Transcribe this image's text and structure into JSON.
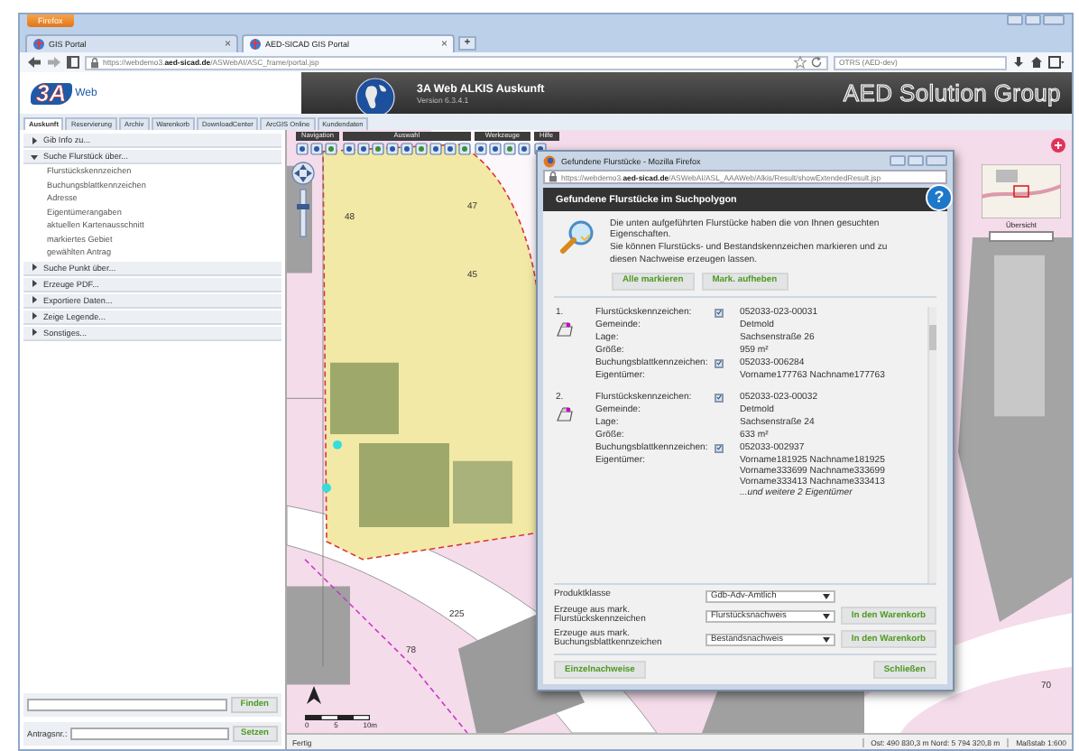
{
  "browser": {
    "menu_button": "Firefox",
    "tabs": [
      {
        "label": "GIS Portal",
        "close": "×",
        "selected": false
      },
      {
        "label": "AED-SICAD GIS Portal",
        "close": "×",
        "selected": true
      }
    ],
    "new_tab": "+",
    "url": "https://webdemo3.**aed-sicad.de**/ASWebAI/ASC_frame/portal.jsp",
    "search_placeholder": "OTRS (AED-dev)"
  },
  "header": {
    "logo": "3A",
    "logo_suffix": "Web",
    "title": "3A Web ALKIS Auskunft",
    "version": "Version 6.3.4.1",
    "brand": "AED Solution Group"
  },
  "app_tabs": [
    {
      "label": "Auskunft",
      "selected": true
    },
    {
      "label": "Reservierung",
      "selected": false
    },
    {
      "label": "Archiv",
      "selected": false
    },
    {
      "label": "Warenkorb",
      "selected": false
    },
    {
      "label": "DownloadCenter",
      "selected": false
    },
    {
      "label": "ArcGIS Online",
      "selected": false
    },
    {
      "label": "Kundendaten",
      "selected": false
    }
  ],
  "sidebar": {
    "sections": [
      {
        "label": "Gib Info zu...",
        "expanded": false
      },
      {
        "label": "Suche Flurstück über...",
        "expanded": true,
        "children": [
          {
            "label": "Flurstückskennzeichen"
          },
          {
            "label": "Buchungsblattkennzeichen"
          },
          {
            "label": "Adresse"
          },
          {
            "label": "Eigentümerangaben"
          },
          {
            "label": "aktuellen Kartenausschnitt"
          },
          {
            "label": "markiertes Gebiet"
          },
          {
            "label": "gewählten Antrag"
          }
        ]
      },
      {
        "label": "Suche Punkt über...",
        "expanded": false
      },
      {
        "label": "Erzeuge PDF...",
        "expanded": false
      },
      {
        "label": "Exportiere Daten...",
        "expanded": false
      },
      {
        "label": "Zeige Legende...",
        "expanded": false
      },
      {
        "label": "Sonstiges...",
        "expanded": false
      }
    ],
    "search_button": "Finden",
    "request_label": "Antragsnr.:",
    "request_button": "Setzen"
  },
  "map": {
    "toolbar": [
      "Navigation",
      "Auswahl",
      "Werkzeuge",
      "Hilfe"
    ],
    "labels": [
      "48",
      "47",
      "45",
      "225",
      "78",
      "70"
    ],
    "scale_labels": [
      "0",
      "5",
      "10m"
    ],
    "overview": "Übersicht"
  },
  "dialog": {
    "window_title": "Gefundene Flurstücke - Mozilla Firefox",
    "url": "https://webdemo3.**aed-sicad.de**/ASWebAI/ASL_AAAWeb/Alkis/Result/showExtendedResult.jsp",
    "heading": "Gefundene Flurstücke im Suchpolygon",
    "help": "?",
    "intro": [
      "Die unten aufgeführten Flurstücke haben die von Ihnen gesuchten Eigenschaften.",
      "Sie können Flurstücks- und Bestandskennzeichen markieren und zu diesen Nachweise erzeugen lassen."
    ],
    "buttons": [
      "Alle markieren",
      "Mark. aufheben"
    ],
    "results": [
      {
        "number": "1.",
        "fields": [
          {
            "kind": "check",
            "label": "Flurstückskennzeichen:",
            "checked": true,
            "lines": [
              "052033-023-00031"
            ]
          },
          {
            "kind": "plain",
            "label": "Gemeinde:",
            "lines": [
              "Detmold"
            ]
          },
          {
            "kind": "plain",
            "label": "Lage:",
            "lines": [
              "Sachsenstraße 26"
            ]
          },
          {
            "kind": "plain",
            "label": "Größe:",
            "lines": [
              "959 m²"
            ]
          },
          {
            "kind": "check",
            "label": "Buchungsblattkennzeichen:",
            "checked": true,
            "lines": [
              "052033-006284"
            ]
          },
          {
            "kind": "plain",
            "label": "Eigentümer:",
            "lines": [
              "Vorname177763 Nachname177763"
            ]
          }
        ]
      },
      {
        "number": "2.",
        "fields": [
          {
            "kind": "check",
            "label": "Flurstückskennzeichen:",
            "checked": true,
            "lines": [
              "052033-023-00032"
            ]
          },
          {
            "kind": "plain",
            "label": "Gemeinde:",
            "lines": [
              "Detmold"
            ]
          },
          {
            "kind": "plain",
            "label": "Lage:",
            "lines": [
              "Sachsenstraße 24"
            ]
          },
          {
            "kind": "plain",
            "label": "Größe:",
            "lines": [
              "633 m²"
            ]
          },
          {
            "kind": "check",
            "label": "Buchungsblattkennzeichen:",
            "checked": true,
            "lines": [
              "052033-002937"
            ]
          },
          {
            "kind": "plain",
            "label": "Eigentümer:",
            "lines": [
              "Vorname181925 Nachname181925",
              "Vorname333699 Nachname333699",
              "Vorname333413 Nachname333413",
              "*...und weitere 2 Eigentümer*"
            ]
          }
        ]
      }
    ],
    "form": [
      {
        "label": "Produktklasse",
        "value": "Gdb-Adv-Amtlich"
      },
      {
        "label": "Erzeuge aus mark. Flurstückskennzeichen",
        "value": "Flurstücksnachweis",
        "button": "In den Warenkorb"
      },
      {
        "label": "Erzeuge aus mark. Buchungsblattkennzeichen",
        "value": "Bestandsnachweis",
        "button": "In den Warenkorb"
      }
    ],
    "footer_buttons": [
      "Einzelnachweise",
      "Schließen"
    ]
  },
  "status_bar": {
    "text": "Fertig",
    "coordinates": "Ost: 490 830,3 m  Nord: 5 794 320,8 m",
    "scale": "Maßstab 1:600"
  }
}
